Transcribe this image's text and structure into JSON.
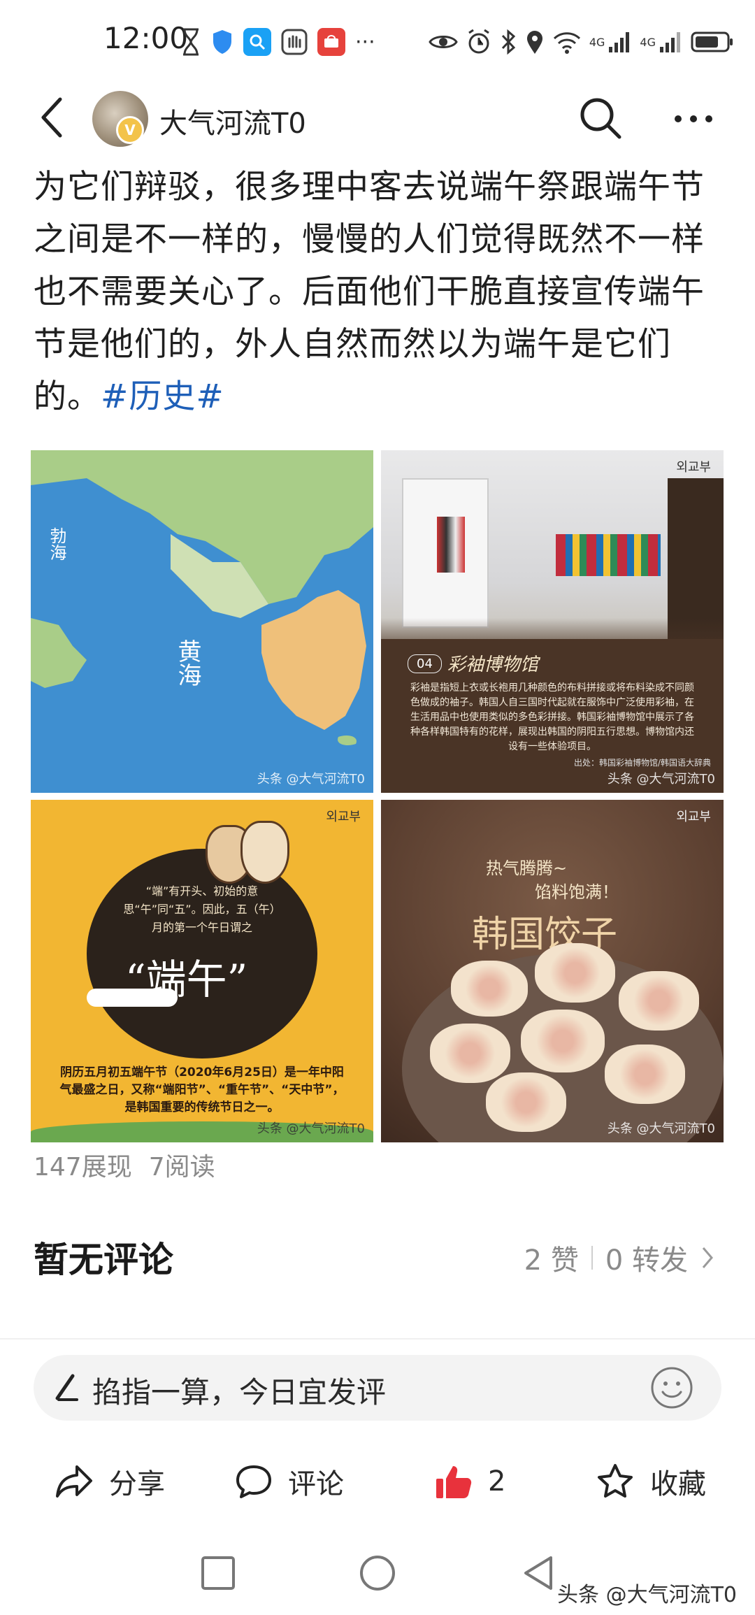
{
  "status_bar": {
    "time": "12:00",
    "more": "···",
    "net1": "4G",
    "net2": "4G"
  },
  "header": {
    "author": "大气河流T0",
    "verified_badge": "V"
  },
  "post": {
    "text": "为它们辩驳，很多理中客去说端午祭跟端午节之间是不一样的，慢慢的人们觉得既然不一样也不需要关心了。后面他们干脆直接宣传端午节是他们的，外人自然而然以为端午是它们的。",
    "hashtag": "#历史#"
  },
  "images": {
    "map": {
      "sea": "黄海",
      "bohai": "勃海",
      "watermark": "头条 @大气河流T0"
    },
    "museum": {
      "badge": "04",
      "title": "彩袖博物馆",
      "logo": "외교부",
      "caption": "彩袖是指短上衣或长袍用几种颜色的布料拼接或将布料染成不同颜色做成的袖子。韩国人自三国时代起就在服饰中广泛使用彩袖，在生活用品中也使用类似的多色彩拼接。韩国彩袖博物馆中展示了各种各样韩国特有的花样，展现出韩国的阴阳五行思想。博物馆内还设有一些体验项目。",
      "source": "出处：韩国彩袖博物馆/韩国语大辞典"
    },
    "dano": {
      "logo": "외교부",
      "intro": "“端”有开头、初始的意思“午”同“五”。因此，五（午）月的第一个午日谓之",
      "big_title": "“端午”",
      "footer": "阴历五月初五端午节（2020年6月25日）是一年中阳气最盛之日，又称“端阳节”、“重午节”、“天中节”，是韩国重要的传统节日之一。"
    },
    "dumpling": {
      "logo": "외교부",
      "tagline1": "热气腾腾~",
      "tagline2": "馅料饱满！",
      "title": "韩国饺子"
    }
  },
  "stats": {
    "views": "147展现",
    "reads": "7阅读"
  },
  "comments": {
    "empty_label": "暂无评论",
    "likes": "2 赞",
    "forwards": "0 转发"
  },
  "comment_input": {
    "placeholder": "掐指一算，今日宜发评"
  },
  "actions": {
    "share": "分享",
    "comment": "评论",
    "like_count": "2",
    "favorite": "收藏"
  },
  "watermark": "头条 @大气河流T0",
  "colors": {
    "hashtag": "#1e5fb8",
    "like": "#e8323c",
    "museum_bg": "#4a3426",
    "dano_bg": "#f2b632",
    "dumpling_bg": "#5b3f30"
  }
}
